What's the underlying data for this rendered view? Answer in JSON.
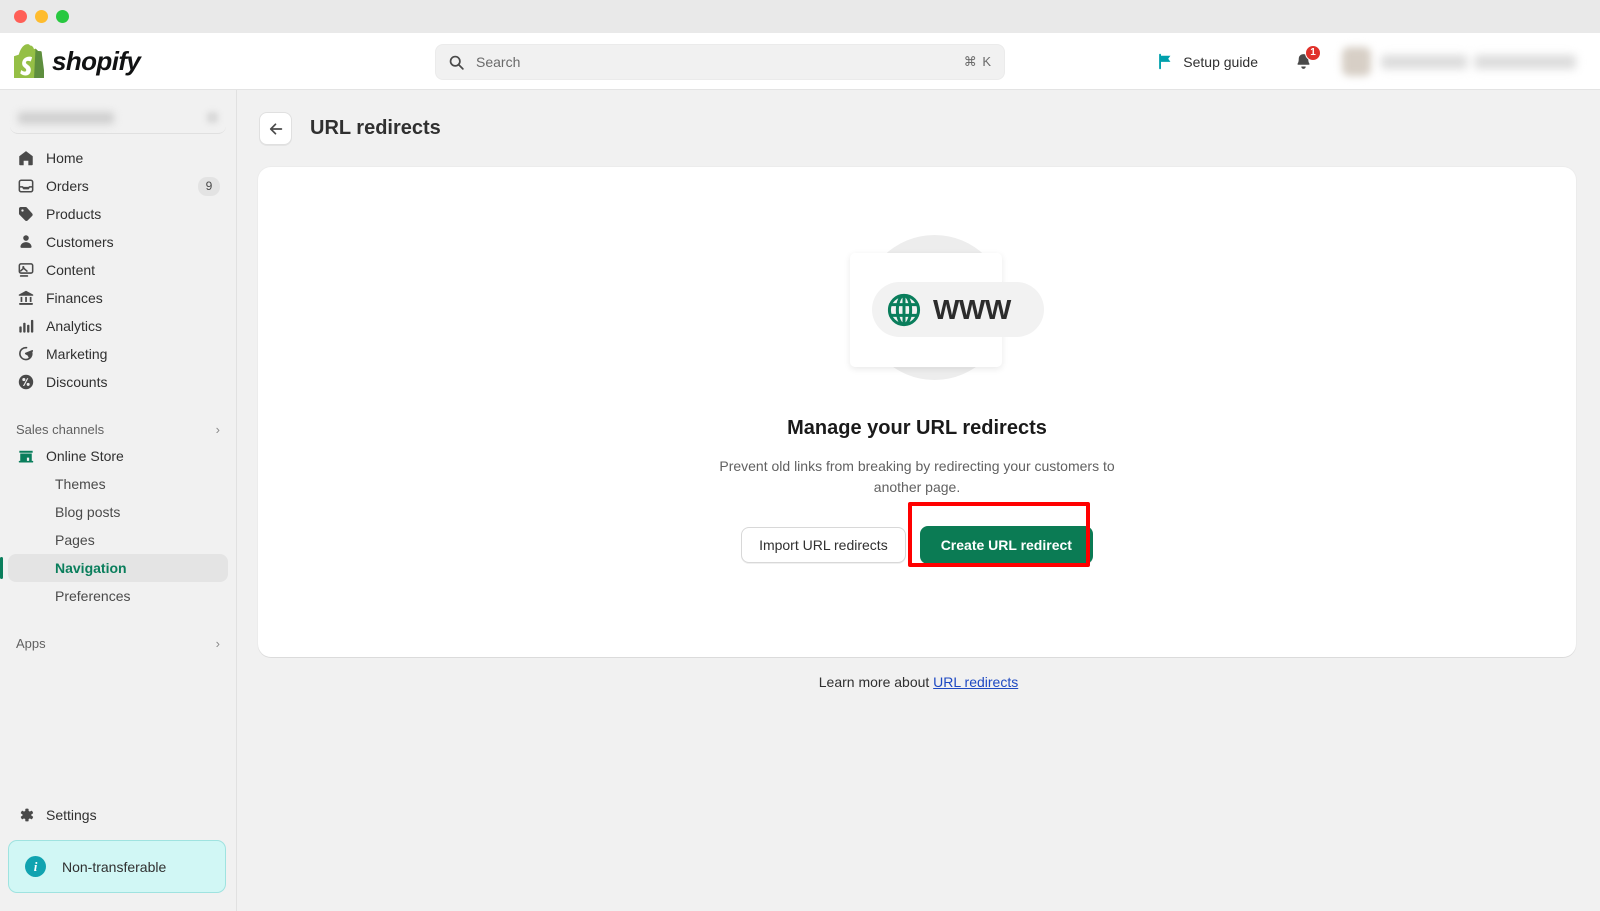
{
  "window": {
    "traffic_lights": [
      "close",
      "minimize",
      "maximize"
    ]
  },
  "topbar": {
    "brand": "shopify",
    "search": {
      "placeholder": "Search",
      "shortcut": "⌘ K",
      "icon": "search-icon"
    },
    "setup_guide": {
      "label": "Setup guide",
      "icon": "flag-icon"
    },
    "notifications": {
      "icon": "bell-icon",
      "count": "1"
    },
    "user": {
      "name": "",
      "avatar": "user-avatar"
    }
  },
  "sidebar": {
    "store_switcher": {
      "name": "",
      "icon": "chevron-down-icon"
    },
    "items": [
      {
        "label": "Home",
        "icon": "home-icon",
        "badge": ""
      },
      {
        "label": "Orders",
        "icon": "orders-icon",
        "badge": "9"
      },
      {
        "label": "Products",
        "icon": "products-icon",
        "badge": ""
      },
      {
        "label": "Customers",
        "icon": "customers-icon",
        "badge": ""
      },
      {
        "label": "Content",
        "icon": "content-icon",
        "badge": ""
      },
      {
        "label": "Finances",
        "icon": "finances-icon",
        "badge": ""
      },
      {
        "label": "Analytics",
        "icon": "analytics-icon",
        "badge": ""
      },
      {
        "label": "Marketing",
        "icon": "marketing-icon",
        "badge": ""
      },
      {
        "label": "Discounts",
        "icon": "discounts-icon",
        "badge": ""
      }
    ],
    "sales_channels": {
      "label": "Sales channels",
      "chevron": "›",
      "channel": {
        "label": "Online Store",
        "icon": "store-icon"
      },
      "subitems": [
        {
          "label": "Themes",
          "active": false
        },
        {
          "label": "Blog posts",
          "active": false
        },
        {
          "label": "Pages",
          "active": false
        },
        {
          "label": "Navigation",
          "active": true
        },
        {
          "label": "Preferences",
          "active": false
        }
      ]
    },
    "apps": {
      "label": "Apps",
      "chevron": "›"
    },
    "settings": {
      "label": "Settings",
      "icon": "gear-icon"
    },
    "banner": {
      "label": "Non-transferable",
      "icon": "info-icon",
      "bg_color": "#d1f7f5",
      "icon_color": "#11a3b0"
    }
  },
  "main": {
    "back_button_icon": "arrow-left-icon",
    "page_title": "URL redirects",
    "empty_state": {
      "illustration": {
        "globe_icon": "globe-icon",
        "www_text": "WWW"
      },
      "title": "Manage your URL redirects",
      "description": "Prevent old links from breaking by redirecting your customers to another page.",
      "secondary_button": "Import URL redirects",
      "primary_button": "Create URL redirect",
      "primary_button_color": "#0b7b54",
      "highlight_color": "#ff0000"
    },
    "footer": {
      "prefix": "Learn more about ",
      "link": "URL redirects",
      "link_color": "#1e49c2"
    }
  }
}
